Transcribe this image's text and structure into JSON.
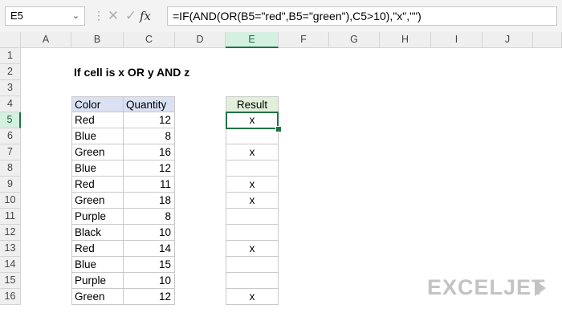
{
  "name_box": "E5",
  "formula": "=IF(AND(OR(B5=\"red\",B5=\"green\"),C5>10),\"x\",\"\")",
  "fx_label": "fx",
  "columns": [
    "A",
    "B",
    "C",
    "D",
    "E",
    "F",
    "G",
    "H",
    "I",
    "J"
  ],
  "selected_column": "E",
  "rows": [
    "1",
    "2",
    "3",
    "4",
    "5",
    "6",
    "7",
    "8",
    "9",
    "10",
    "11",
    "12",
    "13",
    "14",
    "15",
    "16"
  ],
  "selected_row": "5",
  "title": "If cell is x OR y AND z",
  "table": {
    "headers": {
      "color": "Color",
      "quantity": "Quantity",
      "result": "Result"
    },
    "rows": [
      {
        "color": "Red",
        "quantity": "12",
        "result": "x"
      },
      {
        "color": "Blue",
        "quantity": "8",
        "result": ""
      },
      {
        "color": "Green",
        "quantity": "16",
        "result": "x"
      },
      {
        "color": "Blue",
        "quantity": "12",
        "result": ""
      },
      {
        "color": "Red",
        "quantity": "11",
        "result": "x"
      },
      {
        "color": "Green",
        "quantity": "18",
        "result": "x"
      },
      {
        "color": "Purple",
        "quantity": "8",
        "result": ""
      },
      {
        "color": "Black",
        "quantity": "10",
        "result": ""
      },
      {
        "color": "Red",
        "quantity": "14",
        "result": "x"
      },
      {
        "color": "Blue",
        "quantity": "15",
        "result": ""
      },
      {
        "color": "Purple",
        "quantity": "10",
        "result": ""
      },
      {
        "color": "Green",
        "quantity": "12",
        "result": "x"
      }
    ]
  },
  "logo_text": "EXCELJET",
  "colors": {
    "accent": "#217346",
    "header_fill": "#d9e1f2",
    "result_fill": "#e2efda"
  }
}
